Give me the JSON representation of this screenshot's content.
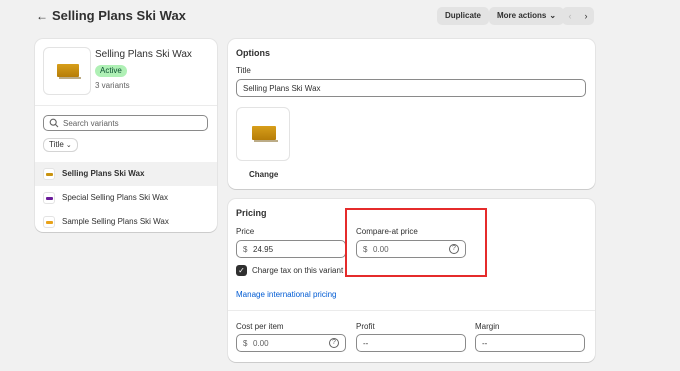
{
  "header": {
    "title": "Selling Plans Ski Wax",
    "duplicate_label": "Duplicate",
    "more_actions_label": "More actions",
    "prev_icon": "chevron-left-icon",
    "next_icon": "chevron-right-icon"
  },
  "product": {
    "name": "Selling Plans Ski Wax",
    "status": "Active",
    "variant_count": "3 variants",
    "search_placeholder": "Search variants",
    "filter_label": "Title",
    "variants": [
      {
        "label": "Selling Plans Ski Wax",
        "color": "#c9930f"
      },
      {
        "label": "Special Selling Plans Ski Wax",
        "color": "#6a1b9a"
      },
      {
        "label": "Sample Selling Plans Ski Wax",
        "color": "#e8a21a"
      }
    ]
  },
  "options": {
    "heading": "Options",
    "title_label": "Title",
    "title_value": "Selling Plans Ski Wax",
    "change_label": "Change"
  },
  "pricing": {
    "heading": "Pricing",
    "price_label": "Price",
    "currency": "$",
    "price_value": "24.95",
    "compare_label": "Compare-at price",
    "compare_value": "0.00",
    "charge_tax_label": "Charge tax on this variant",
    "charge_tax_checked": true,
    "intl_link": "Manage international pricing",
    "cost_label": "Cost per item",
    "cost_value": "0.00",
    "profit_label": "Profit",
    "profit_value": "--",
    "margin_label": "Margin",
    "margin_value": "--"
  },
  "colors": {
    "highlight": "#e52b2b",
    "link": "#005bd3",
    "active_badge": "#aff0b5"
  }
}
